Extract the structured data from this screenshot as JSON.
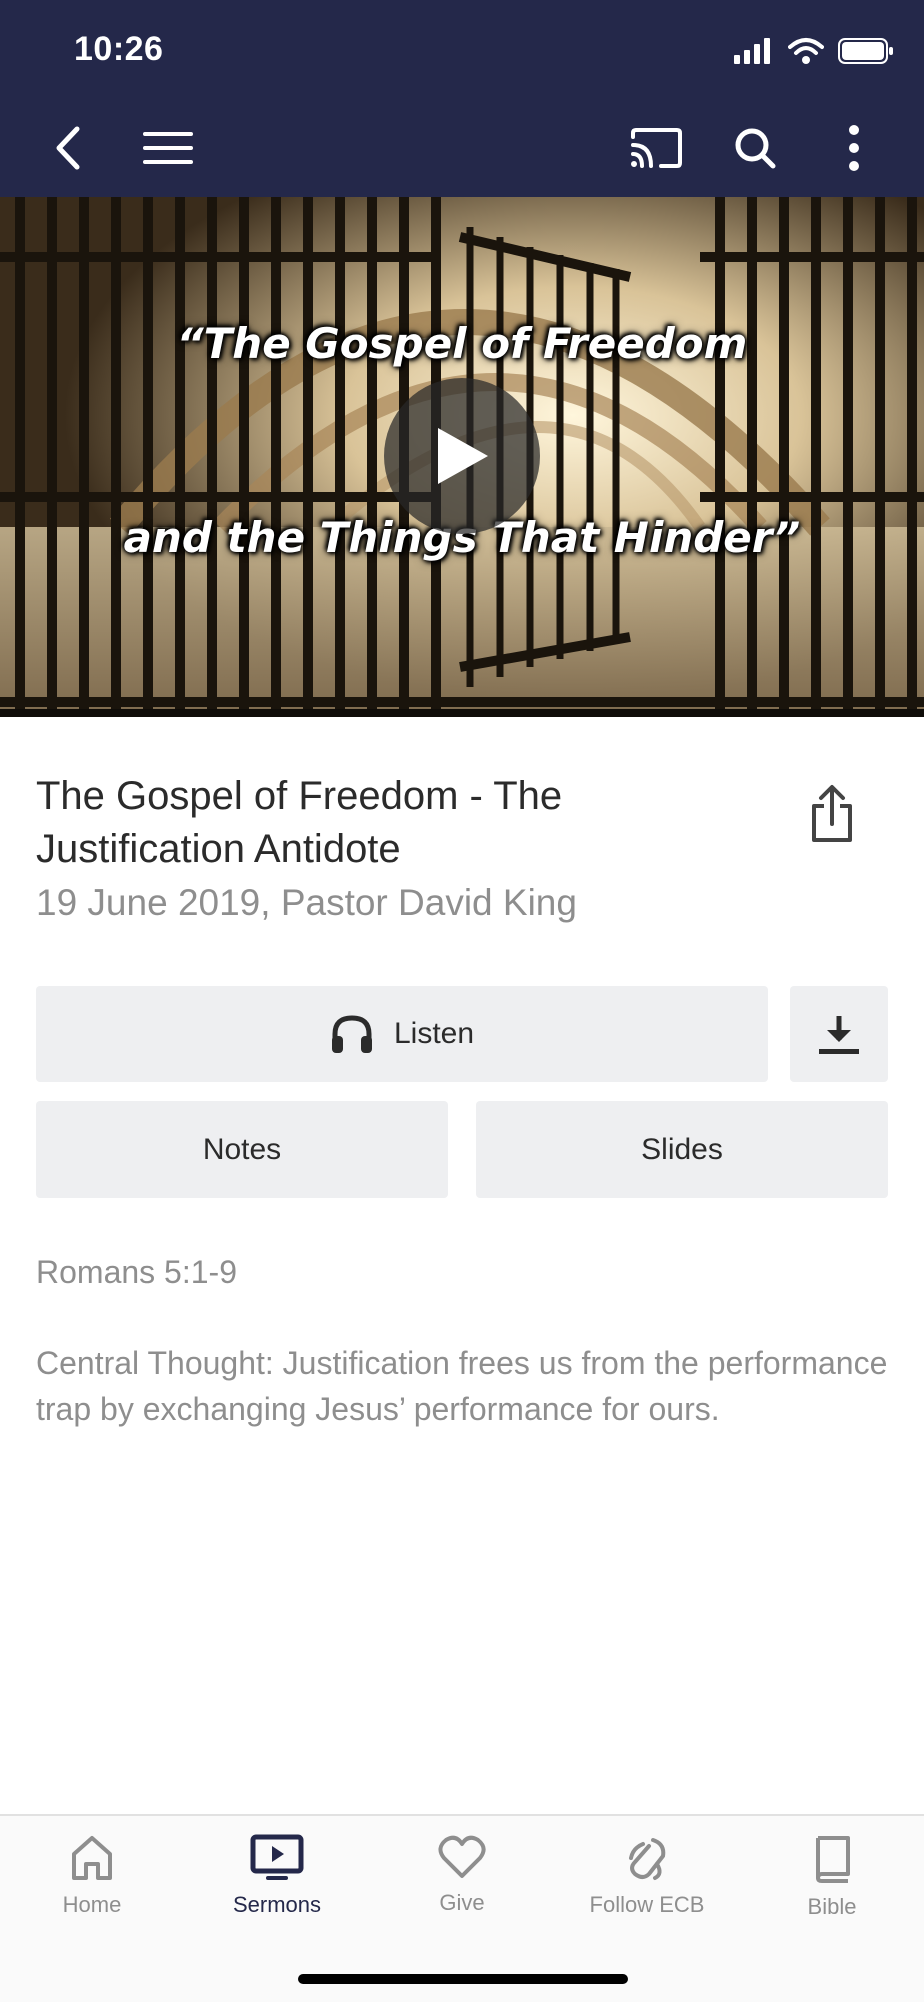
{
  "status_bar": {
    "time": "10:26"
  },
  "colors": {
    "header_bg": "#24284a",
    "button_bg": "#eeeff1",
    "active_tab": "#24284a",
    "inactive_tab": "#8e8e8e"
  },
  "toolbar": {
    "back_icon": "chevron-left-icon",
    "menu_icon": "hamburger-menu-icon",
    "cast_icon": "cast-icon",
    "search_icon": "search-icon",
    "more_icon": "more-vertical-icon"
  },
  "hero": {
    "line1": "“The Gospel of Freedom",
    "line2": "and the Things That Hinder”",
    "play_icon": "play-icon"
  },
  "sermon": {
    "title": "The Gospel of Freedom - The Justification Antidote",
    "meta": "19 June 2019, Pastor David King",
    "scripture": "Romans 5:1-9",
    "description": "Central Thought:  Justification frees us from the performance trap by exchanging Jesus’ performance for ours."
  },
  "actions": {
    "listen_label": "Listen",
    "notes_label": "Notes",
    "slides_label": "Slides"
  },
  "tabs": [
    {
      "label": "Home",
      "icon": "home-icon",
      "active": false
    },
    {
      "label": "Sermons",
      "icon": "tv-play-icon",
      "active": true
    },
    {
      "label": "Give",
      "icon": "heart-icon",
      "active": false
    },
    {
      "label": "Follow ECB",
      "icon": "follow-icon",
      "active": false
    },
    {
      "label": "Bible",
      "icon": "book-icon",
      "active": false
    }
  ]
}
